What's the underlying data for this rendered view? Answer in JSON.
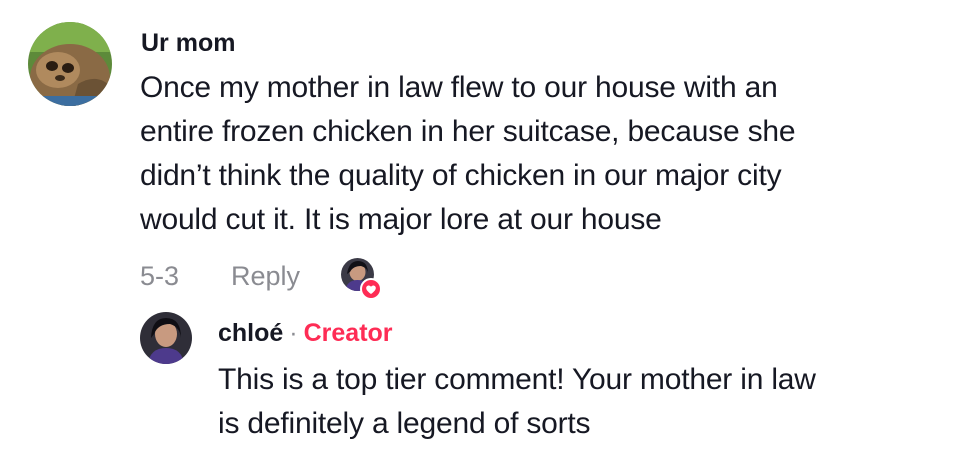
{
  "comment": {
    "username": "Ur mom",
    "text_lines": [
      "Once my mother in law flew to our house with an",
      "entire frozen chicken in her suitcase, because she",
      "didn’t think the quality of chicken in our major city",
      "would cut it. It is major lore at our house"
    ],
    "date": "5-3",
    "reply_label": "Reply",
    "avatar_icon": "sloth-avatar",
    "creator_liked": true
  },
  "reply": {
    "username": "chloé",
    "separator": "·",
    "badge": "Creator",
    "text_lines": [
      "This is a top tier comment! Your mother in law",
      "is definitely a legend of sorts"
    ],
    "avatar_icon": "creator-avatar"
  },
  "colors": {
    "text": "#161823",
    "muted": "#8a8b91",
    "accent": "#fe2c55"
  }
}
